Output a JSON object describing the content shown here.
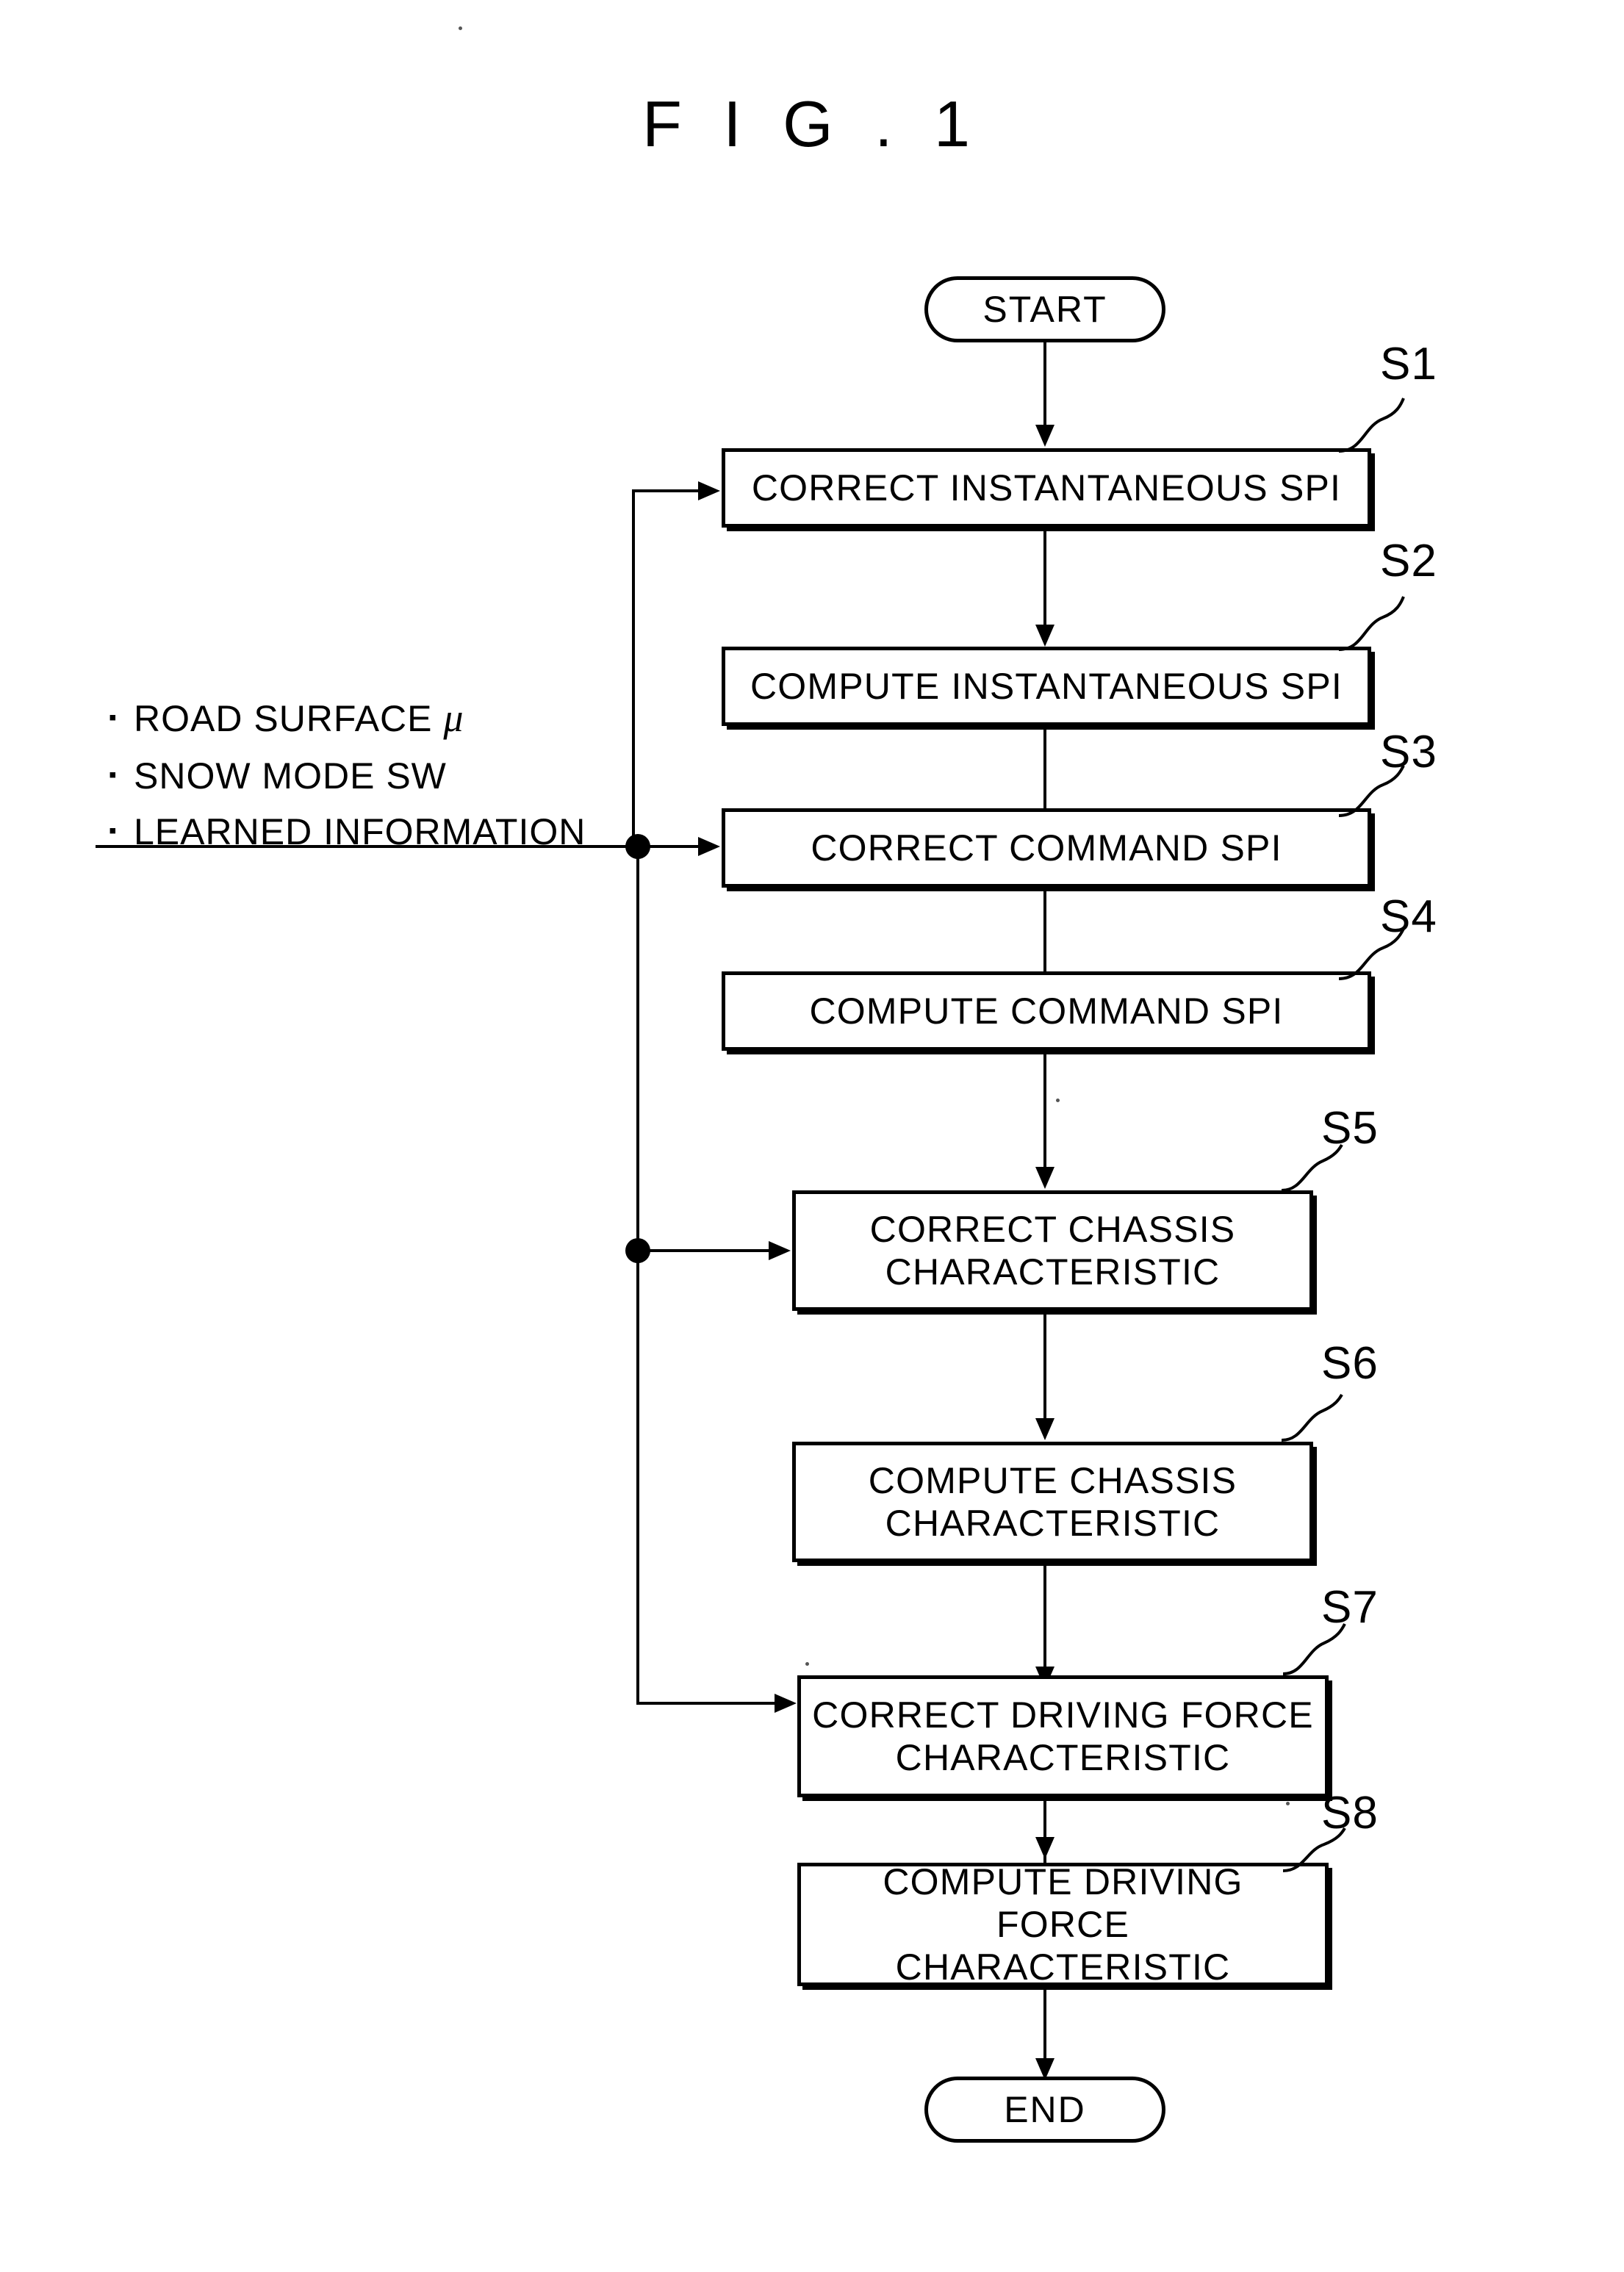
{
  "figure": {
    "title": "F I G . 1"
  },
  "flowchart": {
    "start_label": "START",
    "end_label": "END",
    "inputs": {
      "bullet": "・",
      "items": [
        "ROAD SURFACE  μ",
        "SNOW MODE SW",
        "LEARNED INFORMATION"
      ],
      "items_plain": [
        "ROAD SURFACE",
        "SNOW MODE SW",
        "LEARNED INFORMATION"
      ],
      "mu_symbol": "μ"
    },
    "steps": [
      {
        "id": "S1",
        "label": "CORRECT INSTANTANEOUS SPI",
        "lines": [
          "CORRECT INSTANTANEOUS SPI"
        ]
      },
      {
        "id": "S2",
        "label": "COMPUTE INSTANTANEOUS SPI",
        "lines": [
          "COMPUTE INSTANTANEOUS SPI"
        ]
      },
      {
        "id": "S3",
        "label": "CORRECT COMMAND SPI",
        "lines": [
          "CORRECT COMMAND SPI"
        ]
      },
      {
        "id": "S4",
        "label": "COMPUTE COMMAND SPI",
        "lines": [
          "COMPUTE COMMAND SPI"
        ]
      },
      {
        "id": "S5",
        "label": "CORRECT CHASSIS CHARACTERISTIC",
        "lines": [
          "CORRECT CHASSIS",
          "CHARACTERISTIC"
        ]
      },
      {
        "id": "S6",
        "label": "COMPUTE CHASSIS CHARACTERISTIC",
        "lines": [
          "COMPUTE CHASSIS",
          "CHARACTERISTIC"
        ]
      },
      {
        "id": "S7",
        "label": "CORRECT DRIVING FORCE CHARACTERISTIC",
        "lines": [
          "CORRECT DRIVING FORCE",
          "CHARACTERISTIC"
        ]
      },
      {
        "id": "S8",
        "label": "COMPUTE DRIVING FORCE CHARACTERISTIC",
        "lines": [
          "COMPUTE DRIVING FORCE",
          "CHARACTERISTIC"
        ]
      }
    ],
    "step_texts": {
      "s1": "CORRECT INSTANTANEOUS SPI",
      "s2": "COMPUTE INSTANTANEOUS SPI",
      "s3": "CORRECT COMMAND SPI",
      "s4": "COMPUTE COMMAND SPI",
      "s5": "CORRECT CHASSIS\nCHARACTERISTIC",
      "s6": "COMPUTE CHASSIS\nCHARACTERISTIC",
      "s7": "CORRECT DRIVING FORCE\nCHARACTERISTIC",
      "s8": "COMPUTE DRIVING FORCE\nCHARACTERISTIC"
    },
    "step_ids": {
      "s1": "S1",
      "s2": "S2",
      "s3": "S3",
      "s4": "S4",
      "s5": "S5",
      "s6": "S6",
      "s7": "S7",
      "s8": "S8"
    }
  },
  "colors": {
    "ink": "#000000",
    "paper": "#ffffff"
  }
}
